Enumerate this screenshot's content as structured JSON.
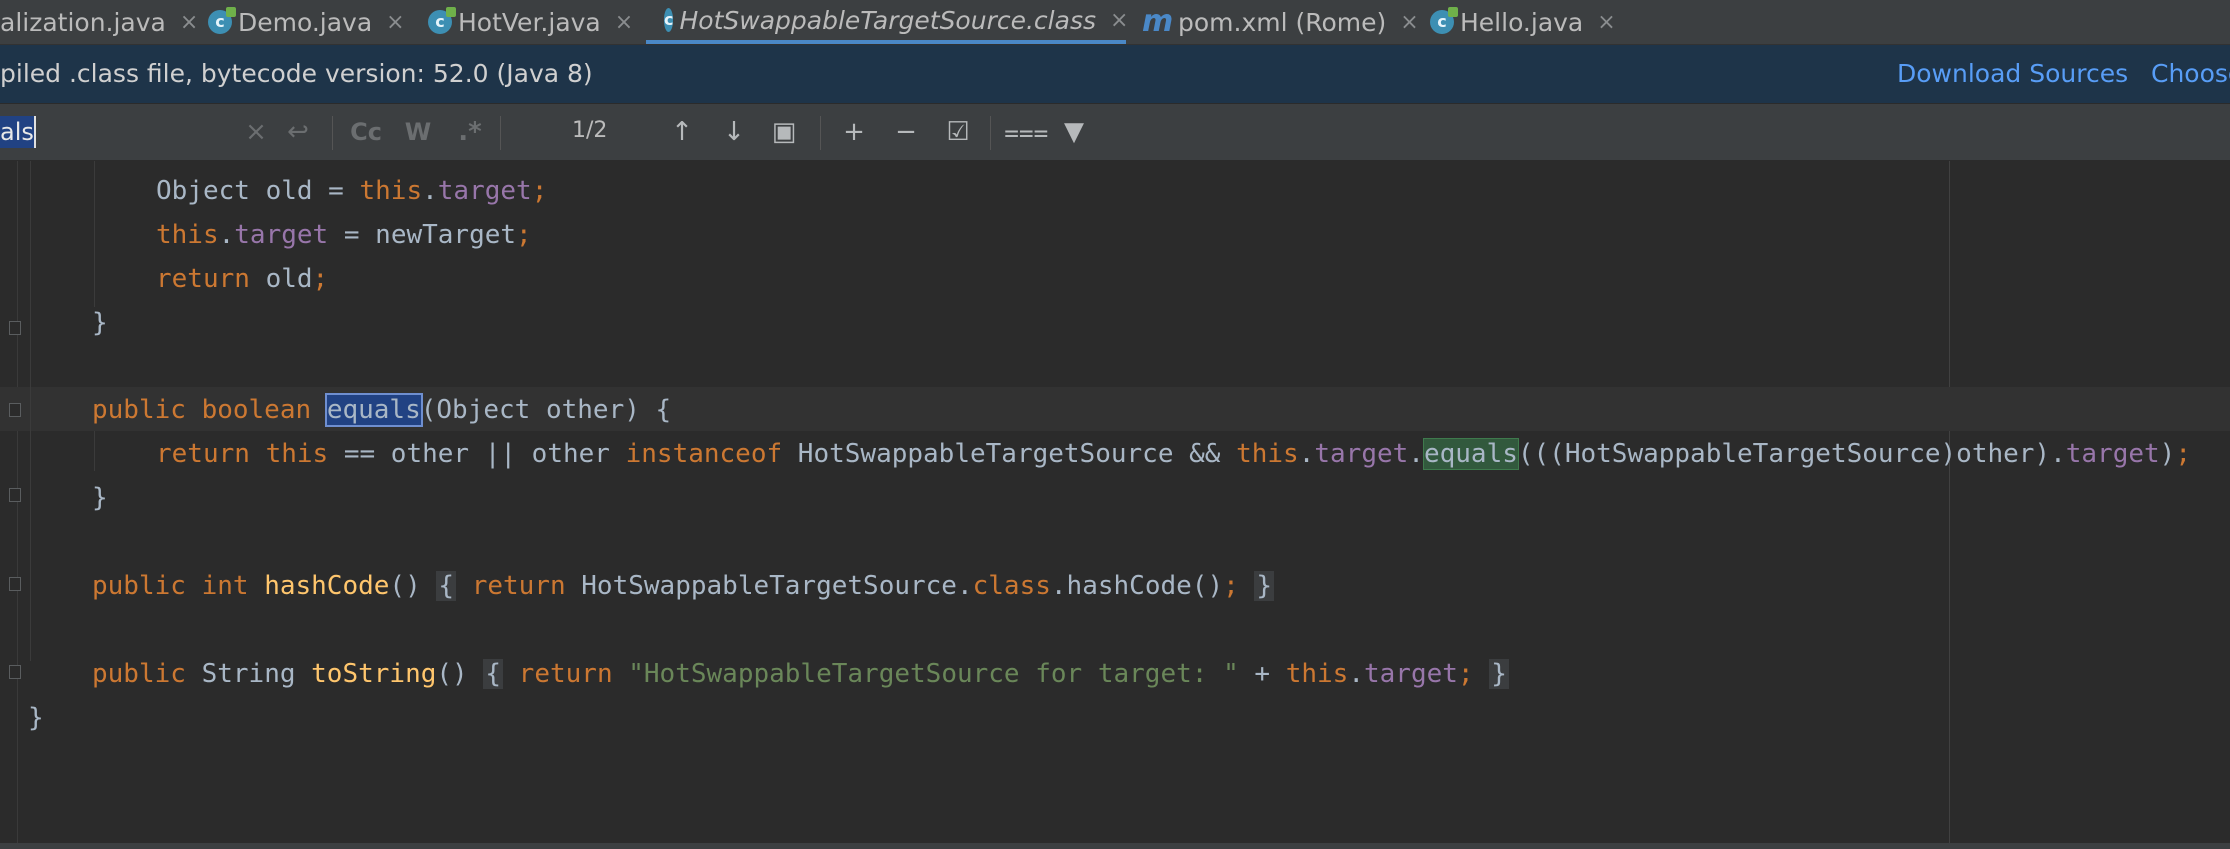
{
  "tabs": [
    {
      "label": "alization.java",
      "icon": "java-class-icon"
    },
    {
      "label": "Demo.java",
      "icon": "java-class-icon"
    },
    {
      "label": "HotVer.java",
      "icon": "java-class-icon"
    },
    {
      "label": "HotSwappableTargetSource.class",
      "icon": "class-file-icon",
      "active": true
    },
    {
      "label": "pom.xml (Rome)",
      "icon": "maven-icon"
    },
    {
      "label": "Hello.java",
      "icon": "java-class-icon"
    }
  ],
  "tab_icon_glyphs": {
    "class": "c",
    "maven": "m",
    "close": "×"
  },
  "banner": {
    "text": "piled .class file, bytecode version: 52.0 (Java 8)",
    "download_sources": "Download Sources",
    "choose_sources": "Choose"
  },
  "search": {
    "query": "als",
    "match_count": "1/2",
    "icons": {
      "clear": "×",
      "newline": "↩",
      "match_case": "Cc",
      "words": "W",
      "regex": ".*",
      "prev": "↑",
      "next": "↓",
      "open_in_window": "▣",
      "add_occurrence": "+",
      "remove_occurrence": "−",
      "select_all": "☑",
      "filter_options": "⩶",
      "filter": "▼"
    }
  },
  "code": {
    "l1": {
      "t1": "Object old = ",
      "t2": "this",
      "t3": ".",
      "t4": "target",
      "t5": ";"
    },
    "l2": {
      "t1": "this",
      "t2": ".",
      "t3": "target",
      "t4": " = newTarget",
      "t5": ";"
    },
    "l3": {
      "t1": "return ",
      "t2": "old",
      "t3": ";"
    },
    "l4": {
      "t1": "}"
    },
    "l5": {
      "t1": "public boolean ",
      "t2": "equals",
      "t3": "(Object other) {"
    },
    "l6": {
      "t1": "return this ",
      "t2": "== other || other ",
      "t3": "instanceof ",
      "t4": "HotSwappableTargetSource && ",
      "t5": "this",
      "t6": ".",
      "t7": "target",
      "t8": ".",
      "t9": "equals",
      "t10": "(((HotSwappableTargetSource)other).",
      "t11": "target",
      "t12": ")",
      "t13": ";"
    },
    "l7": {
      "t1": "}"
    },
    "l8": {
      "t1": "public int ",
      "t2": "hashCode",
      "t3": "() ",
      "t4": "{",
      "t5": " ",
      "t6": "return ",
      "t7": "HotSwappableTargetSource.",
      "t8": "class",
      "t9": ".hashCode()",
      "t10": ";",
      "t11": " ",
      "t12": "}"
    },
    "l9": {
      "t1": "public ",
      "t2": "String ",
      "t3": "toString",
      "t4": "() ",
      "t5": "{",
      "t6": " ",
      "t7": "return ",
      "t8": "\"HotSwappableTargetSource for target: \"",
      "t9": " + ",
      "t10": "this",
      "t11": ".",
      "t12": "target",
      "t13": ";",
      "t14": " ",
      "t15": "}"
    },
    "l10": {
      "t1": "}"
    }
  },
  "colors": {
    "keyword": "#cc7832",
    "field": "#9876aa",
    "method": "#ffc66d",
    "string": "#6a8759",
    "text": "#a9b7c6",
    "link": "#589df6",
    "banner_bg": "#1e3449",
    "editor_bg": "#2b2b2b",
    "selection": "#214283",
    "match_highlight": "#32593d",
    "active_tab_underline": "#4a88c7"
  }
}
